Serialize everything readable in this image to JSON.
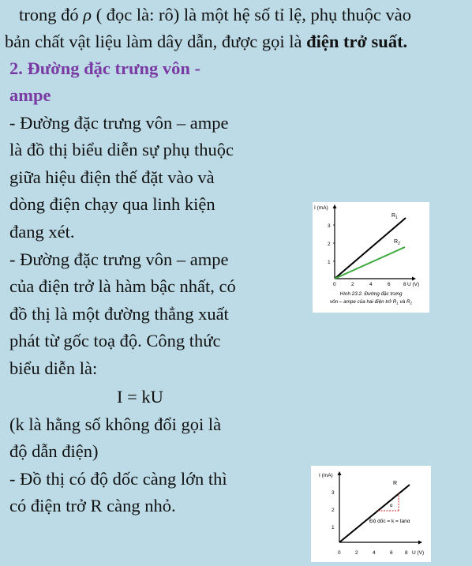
{
  "intro": {
    "line1_pre": "trong đó ",
    "rho": "ρ",
    "line1_post": " ( đọc là: rô) là một hệ số tỉ lệ, phụ thuộc vào",
    "line2_pre": "bản chất vật liệu làm dây dẫn, được gọi là ",
    "line2_bold": "điện trở suất."
  },
  "section": {
    "heading_line1": "2. Đường đặc trưng vôn -",
    "heading_line2": "ampe",
    "lines": [
      "- Đường đặc trưng vôn – ampe",
      "là đồ thị biểu diễn sự phụ thuộc",
      "giữa hiệu điện thế đặt vào và",
      "dòng điện chạy qua linh kiện",
      "đang xét.",
      "- Đường đặc trưng vôn – ampe",
      "của điện trở là hàm bậc nhất, có",
      "đồ thị là một đường thẳng xuất",
      "phát từ gốc toạ độ. Công thức",
      "biểu diễn là:"
    ],
    "formula": "I = kU",
    "lines2": [
      "(k là hằng số không đổi gọi là",
      "độ dẫn điện)",
      "- Đồ thị có độ dốc càng lớn thì",
      "có điện trở R càng nhỏ."
    ]
  },
  "figure1": {
    "ylabel": "I (mA)",
    "xlabel": "U (V)",
    "xticks": [
      "0",
      "2",
      "4",
      "6",
      "8"
    ],
    "yticks": [
      "1",
      "2",
      "3"
    ],
    "series1_label": "R",
    "series1_sub": "1",
    "series2_label": "R",
    "series2_sub": "2",
    "caption_line1": "Hình 23.2. Đường đặc trưng",
    "caption_line2_pre": "vôn – ampe của hai điện trở R",
    "caption_sub1": "1",
    "caption_mid": " và R",
    "caption_sub2": "2",
    "series1_color": "#000000",
    "series2_color": "#3aa83a"
  },
  "figure2": {
    "ylabel": "I (mA)",
    "xlabel": "U (V)",
    "xticks": [
      "0",
      "2",
      "4",
      "6",
      "8"
    ],
    "yticks": [
      "1",
      "2",
      "3"
    ],
    "line_label": "R",
    "alpha": "α",
    "slope_text": "Độ dốc = k = tanα",
    "dash_color": "#d22222"
  }
}
